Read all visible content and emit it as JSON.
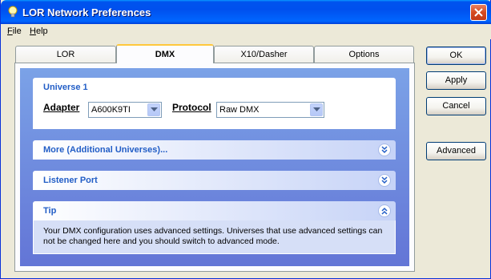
{
  "window": {
    "title": "LOR Network Preferences"
  },
  "menu": [
    {
      "label": "File",
      "underline": "F",
      "rest": "ile"
    },
    {
      "label": "Help",
      "underline": "H",
      "rest": "elp"
    }
  ],
  "tabs": [
    {
      "label": "LOR",
      "active": false
    },
    {
      "label": "DMX",
      "active": true
    },
    {
      "label": "X10/Dasher",
      "active": false
    },
    {
      "label": "Options",
      "active": false
    }
  ],
  "universe1": {
    "title": "Universe 1",
    "adapter_label": "Adapter",
    "adapter_value": "A600K9TI",
    "protocol_label": "Protocol",
    "protocol_value": "Raw DMX"
  },
  "more_group": {
    "title": "More (Additional Universes)..."
  },
  "listener_group": {
    "title": "Listener Port"
  },
  "tip_group": {
    "title": "Tip",
    "text": "Your DMX configuration uses advanced settings.  Universes that use advanced settings can not be changed here and you should switch to advanced mode."
  },
  "buttons": {
    "ok": "OK",
    "apply": "Apply",
    "cancel": "Cancel",
    "advanced": "Advanced"
  },
  "colors": {
    "titlebar": "#0053ee",
    "group_title": "#215dc6",
    "panel_gradient_top": "#7ba2e7",
    "panel_gradient_bottom": "#6375d6"
  }
}
